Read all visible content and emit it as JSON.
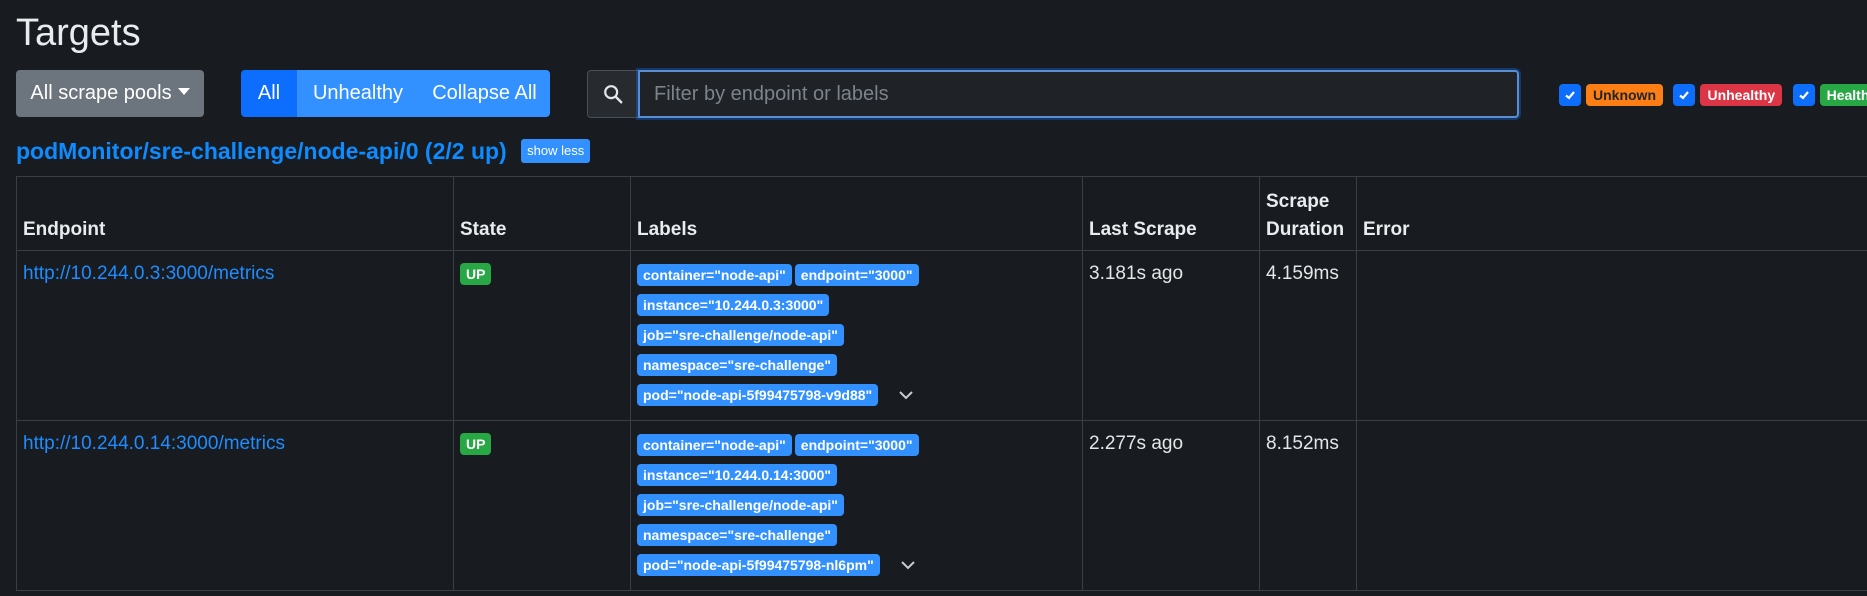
{
  "page": {
    "title": "Targets"
  },
  "toolbar": {
    "scrape_pools_label": "All scrape pools",
    "filter_all": "All",
    "filter_unhealthy": "Unhealthy",
    "collapse_all": "Collapse All",
    "search_placeholder": "Filter by endpoint or labels",
    "search_value": ""
  },
  "health_filters": [
    {
      "label": "Unknown",
      "checked": true,
      "color": "#fd7e14"
    },
    {
      "label": "Unhealthy",
      "checked": true,
      "color": "#dc3545"
    },
    {
      "label": "Healthy",
      "checked": true,
      "color": "#28a745"
    }
  ],
  "pool": {
    "name": "podMonitor/sre-challenge/node-api/0 (2/2 up)",
    "toggle_label": "show less",
    "columns": {
      "endpoint": "Endpoint",
      "state": "State",
      "labels": "Labels",
      "last_scrape": "Last Scrape",
      "scrape_duration": "Scrape Duration",
      "error": "Error"
    },
    "rows": [
      {
        "endpoint": "http://10.244.0.3:3000/metrics",
        "state": "UP",
        "labels": {
          "container": "container=\"node-api\"",
          "endpoint": "endpoint=\"3000\"",
          "instance": "instance=\"10.244.0.3:3000\"",
          "job": "job=\"sre-challenge/node-api\"",
          "namespace": "namespace=\"sre-challenge\"",
          "pod": "pod=\"node-api-5f99475798-v9d88\""
        },
        "last_scrape": "3.181s ago",
        "scrape_duration": "4.159ms",
        "error": ""
      },
      {
        "endpoint": "http://10.244.0.14:3000/metrics",
        "state": "UP",
        "labels": {
          "container": "container=\"node-api\"",
          "endpoint": "endpoint=\"3000\"",
          "instance": "instance=\"10.244.0.14:3000\"",
          "job": "job=\"sre-challenge/node-api\"",
          "namespace": "namespace=\"sre-challenge\"",
          "pod": "pod=\"node-api-5f99475798-nl6pm\""
        },
        "last_scrape": "2.277s ago",
        "scrape_duration": "8.152ms",
        "error": ""
      }
    ]
  },
  "colors": {
    "background": "#181b1f",
    "primary": "#0d6efd",
    "label_badge": "#3391ff",
    "link": "#1f8dff",
    "up_badge": "#28a745"
  }
}
